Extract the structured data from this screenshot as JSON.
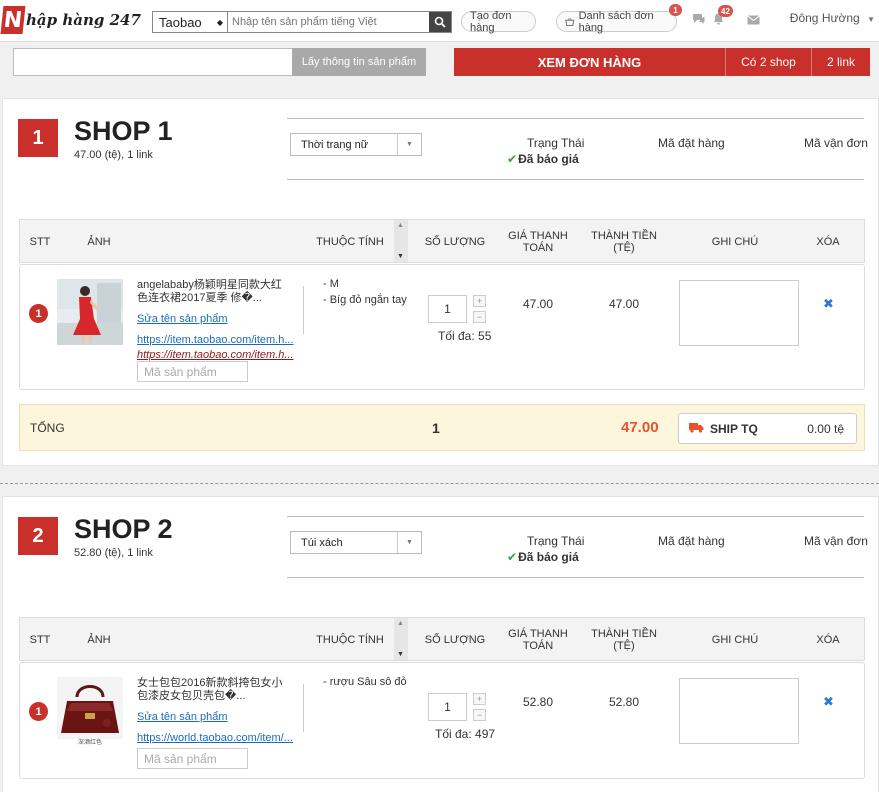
{
  "header": {
    "logo_letter": "N",
    "logo_text": "hập hàng 247",
    "search_site": "Taobao",
    "search_placeholder": "Nhập tên sản phẩm tiếng Việt",
    "create_order": "Tạo đơn hàng",
    "order_list": "Danh sách đơn hàng",
    "order_list_badge": "1",
    "notif_badge": "42",
    "user_name": "Đông Hường"
  },
  "toolbar": {
    "fetch_label": "Lấy thông tin sản phẩm",
    "view_orders": "XEM ĐƠN HÀNG",
    "shop_count": "Có 2 shop",
    "link_count": "2 link"
  },
  "table_headers": {
    "stt": "STT",
    "image": "ẢNH",
    "attributes": "THUỘC TÍNH",
    "quantity": "SỐ LƯỢNG",
    "pay_price": "GIÁ THANH TOÁN",
    "total": "THÀNH TIỀN (TỆ)",
    "note": "GHI CHÚ",
    "delete": "XÓA"
  },
  "labels": {
    "status": "Trạng Thái",
    "order_code": "Mã đặt hàng",
    "tracking_code": "Mã vận đơn",
    "edit_name": "Sửa tên sản phẩm",
    "sku_placeholder": "Mã sản phẩm",
    "total": "TỔNG",
    "ship": "SHIP TQ"
  },
  "shops": [
    {
      "number": "1",
      "title": "SHOP 1",
      "subtitle": "47.00 (tệ), 1 link",
      "category": "Thời trang nữ",
      "status": "Đã báo giá",
      "item": {
        "index": "1",
        "name": "angelababy杨颖明星同款大红色连衣裙2017夏季 修�...",
        "link1": "https://item.taobao.com/item.h...",
        "link2": "https://item.taobao.com/item.h...",
        "attrs": [
          "- M",
          "- Bíg đỏ ngắn tay"
        ],
        "qty": "1",
        "max_qty": "Tối đa: 55",
        "price": "47.00",
        "line_total": "47.00"
      },
      "total_qty": "1",
      "total_amount": "47.00",
      "ship_fee": "0.00 tệ"
    },
    {
      "number": "2",
      "title": "SHOP 2",
      "subtitle": "52.80 (tệ), 1 link",
      "category": "Túi xách",
      "status": "Đã báo giá",
      "item": {
        "index": "1",
        "name": "女士包包2016新款斜挎包女小包漆皮女包贝壳包�...",
        "link1": "https://world.taobao.com/item/...",
        "attrs": [
          "- rượu Sâu sô đỏ"
        ],
        "qty": "1",
        "max_qty": "Tối đa: 497",
        "price": "52.80",
        "line_total": "52.80",
        "thumb_caption": "深酒红色"
      }
    }
  ],
  "colors": {
    "brand_red": "#c9302c",
    "total_orange": "#e8522f",
    "link_blue": "#1a6bbf",
    "ok_green": "#3c9b3c"
  }
}
